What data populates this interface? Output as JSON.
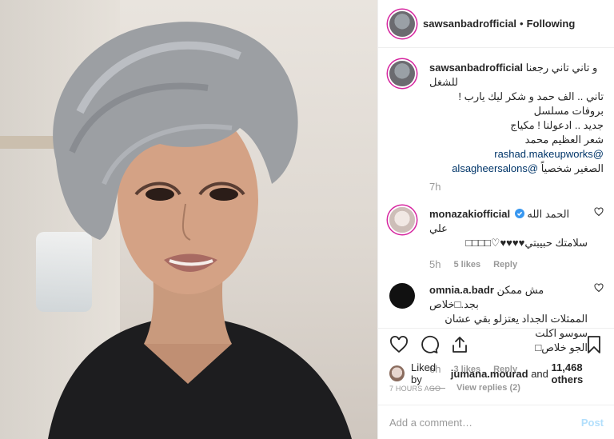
{
  "post": {
    "author": "sawsanbadrofficial",
    "separator": "•",
    "follow_state": "Following"
  },
  "caption": {
    "username": "sawsanbadrofficial",
    "line1": "و تاني تاني رجعنا للشغل",
    "line2": "تاني .. الف حمد و شكر ليك يارب ! بروفات مسلسل",
    "line3": "جديد .. ادعولنا ! مكياج",
    "mention1": "@rashad.makeupworks",
    "line4": "شعر العظيم محمد",
    "mention2": "@alsagheersalons",
    "line5": "الصغير شخصياً",
    "time": "7h"
  },
  "comments": [
    {
      "username": "monazakiofficial",
      "verified": true,
      "text_line1": "الحمد الله علي",
      "text_line2": "سلامتك حبيبتي♥♥♥♥♡□□□□",
      "time": "5h",
      "likes": "5 likes",
      "reply": "Reply"
    },
    {
      "username": "omnia.a.badr",
      "text_line1": "مش ممكن بجد.□خلاص",
      "text_line2": "الممثلات الجداد يعتزلو بقي عشان سوسو اكلت",
      "text_line3": "الجو خلاص□",
      "time": "6h",
      "likes": "3 likes",
      "reply": "Reply",
      "view_replies": "View replies (2)"
    }
  ],
  "likes": {
    "prefix": "Liked by ",
    "user": "jumana.mourad",
    "and": " and ",
    "others": "11,468 others"
  },
  "posted_ago": "7 HOURS AGO",
  "add_comment": {
    "placeholder": "Add a comment…",
    "post_label": "Post"
  },
  "colors": {
    "text": "#262626",
    "muted": "#999999",
    "mention": "#003569",
    "post_disabled": "#b2dffc",
    "verified": "#3897f0",
    "story_ring": "#d6249f"
  }
}
